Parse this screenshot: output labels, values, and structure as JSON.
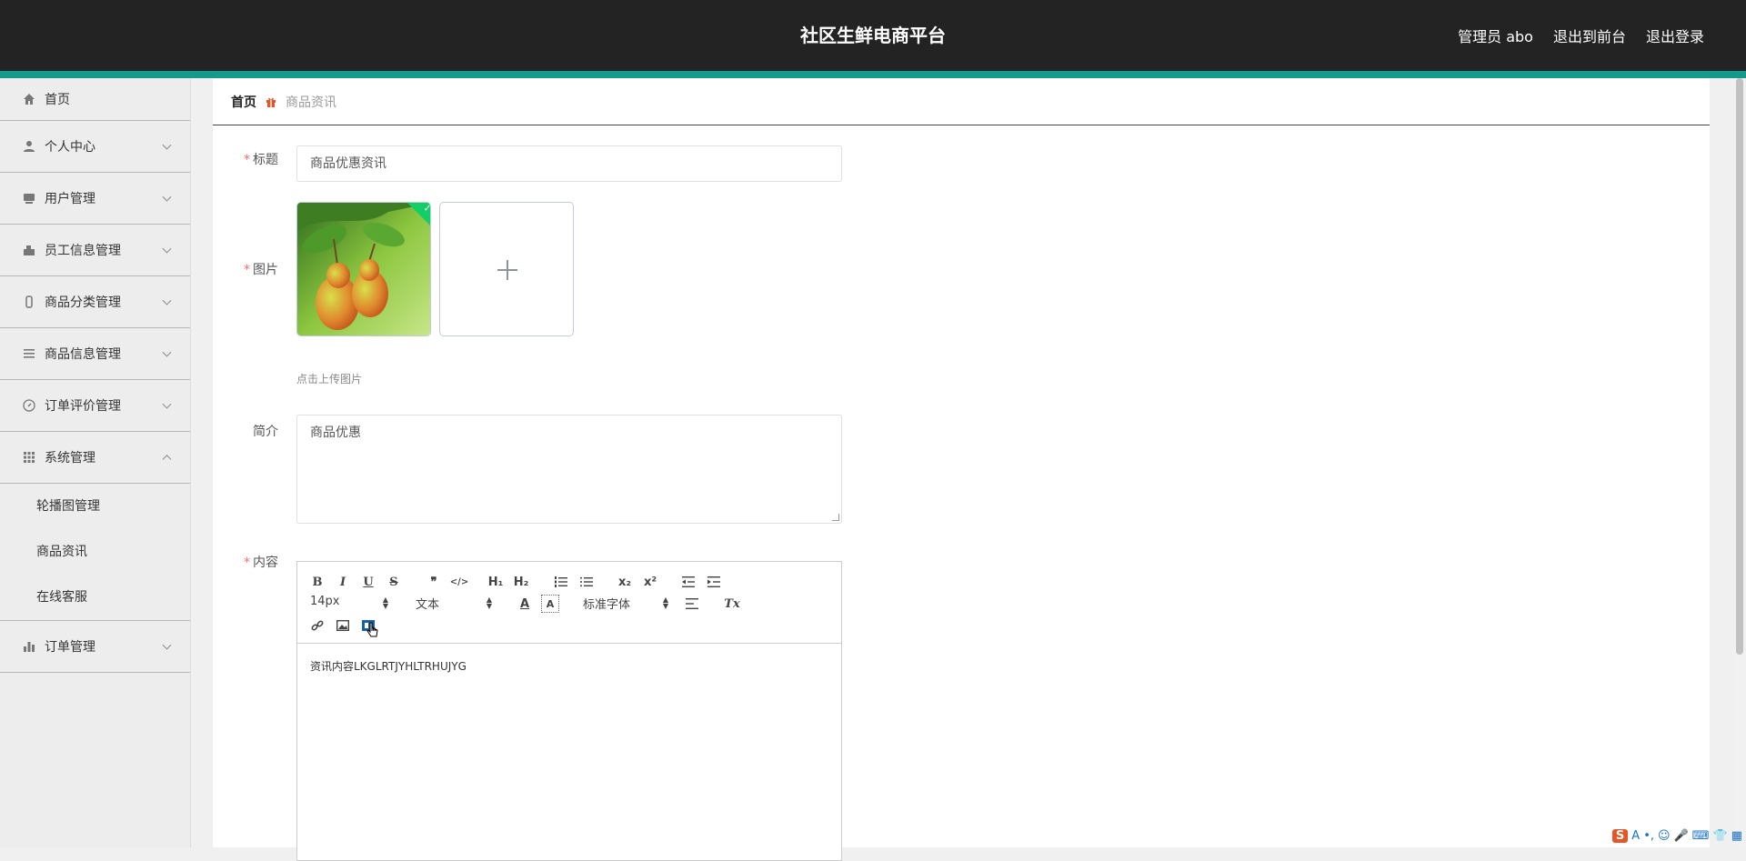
{
  "header": {
    "title": "社区生鲜电商平台",
    "admin_label": "管理员 abo",
    "to_frontend": "退出到前台",
    "logout": "退出登录"
  },
  "sidebar": {
    "items": [
      {
        "label": "首页",
        "icon": "home-icon"
      },
      {
        "label": "个人中心",
        "icon": "user-icon"
      },
      {
        "label": "用户管理",
        "icon": "users-icon"
      },
      {
        "label": "员工信息管理",
        "icon": "staff-icon"
      },
      {
        "label": "商品分类管理",
        "icon": "category-icon"
      },
      {
        "label": "商品信息管理",
        "icon": "list-icon"
      },
      {
        "label": "订单评价管理",
        "icon": "compass-icon"
      },
      {
        "label": "系统管理",
        "icon": "grid-icon"
      },
      {
        "label": "订单管理",
        "icon": "chart-icon"
      }
    ],
    "system_sub": [
      "轮播图管理",
      "商品资讯",
      "在线客服"
    ]
  },
  "breadcrumb": {
    "home": "首页",
    "current": "商品资讯"
  },
  "form": {
    "title_label": "标题",
    "title_value": "商品优惠资讯",
    "image_label": "图片",
    "upload_hint": "点击上传图片",
    "intro_label": "简介",
    "intro_value": "商品优惠",
    "content_label": "内容",
    "content_value": "资讯内容LKGLRTJYHLTRHUJYG",
    "required_mark": "*"
  },
  "editor": {
    "font_size": "14px",
    "header_select": "文本",
    "font_family": "标准字体",
    "buttons": {
      "bold": "B",
      "italic": "I",
      "underline": "U",
      "strike": "S",
      "quote": "❞",
      "code": "</>",
      "h1": "H₁",
      "h2": "H₂",
      "sub": "x₂",
      "sup": "x²",
      "clear": "Tx"
    }
  },
  "ime": {
    "items": [
      "S",
      "A",
      "•,",
      "☺",
      "🎤",
      "⌨",
      "👕",
      "▦"
    ]
  },
  "colors": {
    "topbar": "#232323",
    "accent": "#14998c",
    "required": "#f56c6c",
    "upload_success": "#13ce66"
  }
}
